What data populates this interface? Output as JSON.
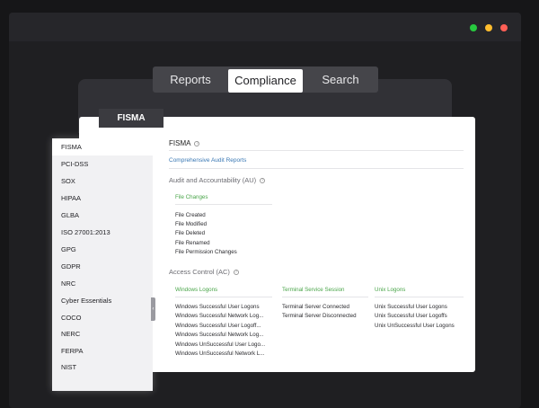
{
  "tabs": {
    "reports": "Reports",
    "compliance": "Compliance",
    "search": "Search"
  },
  "card_tab": "FISMA",
  "sidebar": {
    "items": [
      "FISMA",
      "PCI-DSS",
      "SOX",
      "HIPAA",
      "GLBA",
      "ISO 27001:2013",
      "GPG",
      "GDPR",
      "NRC",
      "Cyber Essentials",
      "COCO",
      "NERC",
      "FERPA",
      "NIST"
    ],
    "active": "FISMA"
  },
  "main": {
    "title": "FISMA",
    "link": "Comprehensive Audit Reports",
    "sections": [
      {
        "title": "Audit and Accountability (AU)",
        "groups": [
          {
            "name": "File Changes",
            "items": [
              "File Created",
              "File Modified",
              "File Deleted",
              "File Renamed",
              "File Permission Changes"
            ]
          }
        ]
      },
      {
        "title": "Access Control (AC)",
        "groups": [
          {
            "name": "Windows Logons",
            "items": [
              "Windows Successful User Logons",
              "Windows Successful Network Log...",
              "Windows Successful User Logoff...",
              "Windows Successful Network Log...",
              "Windows UnSuccessful User Logo...",
              "Windows UnSuccessful Network L..."
            ]
          },
          {
            "name": "Terminal Service Session",
            "items": [
              "Terminal Server Connected",
              "Terminal Server Disconnected"
            ]
          },
          {
            "name": "Unix Logons",
            "items": [
              "Unix Successful User Logons",
              "Unix Successful User Logoffs",
              "Unix UnSuccessful User Logons"
            ]
          }
        ]
      }
    ]
  },
  "colors": {
    "accent_green": "#4aa54a",
    "link_blue": "#3a78b4",
    "dot_green": "#27c93f",
    "dot_yellow": "#ffbd2e",
    "dot_red": "#ff5f56"
  }
}
